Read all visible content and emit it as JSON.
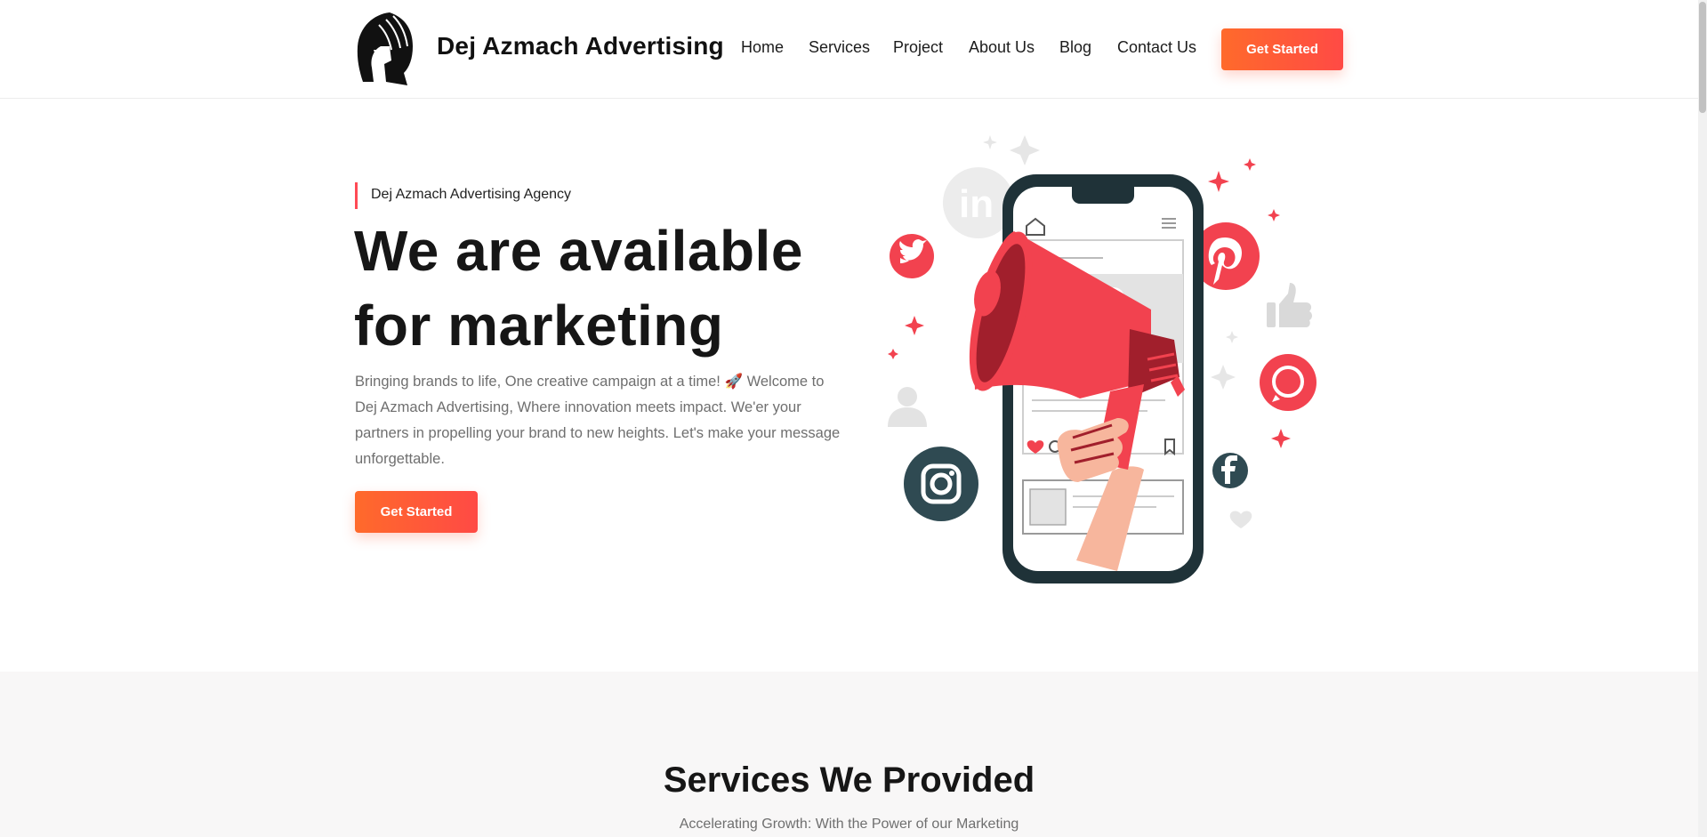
{
  "header": {
    "brand": "Dej Azmach Advertising",
    "logo_icon": "spartan-helmet-icon",
    "nav": [
      {
        "label": "Home"
      },
      {
        "label": "Services"
      },
      {
        "label": "Project"
      },
      {
        "label": "About Us"
      },
      {
        "label": "Blog"
      },
      {
        "label": "Contact Us"
      }
    ],
    "cta_label": "Get Started"
  },
  "hero": {
    "eyebrow": "Dej Azmach Advertising Agency",
    "title_line1": "We are available",
    "title_line2": "for marketing",
    "description": "Bringing brands to life, One creative campaign at a time! 🚀 Welcome to Dej Azmach Advertising, Where innovation meets impact. We'er your partners in propelling your brand to new heights. Let's make your message unforgettable.",
    "cta_label": "Get Started",
    "illustration_icon": "megaphone-phone-social-media-icon"
  },
  "services": {
    "title": "Services We Provided",
    "subtitle": "Accelerating Growth: With the Power of our Marketing"
  },
  "colors": {
    "accent": "#ff5a3c",
    "accent_red": "#ff4a55",
    "text_dark": "#161616",
    "text_muted": "#6f6f6f",
    "section_bg": "#f8f7f7"
  }
}
